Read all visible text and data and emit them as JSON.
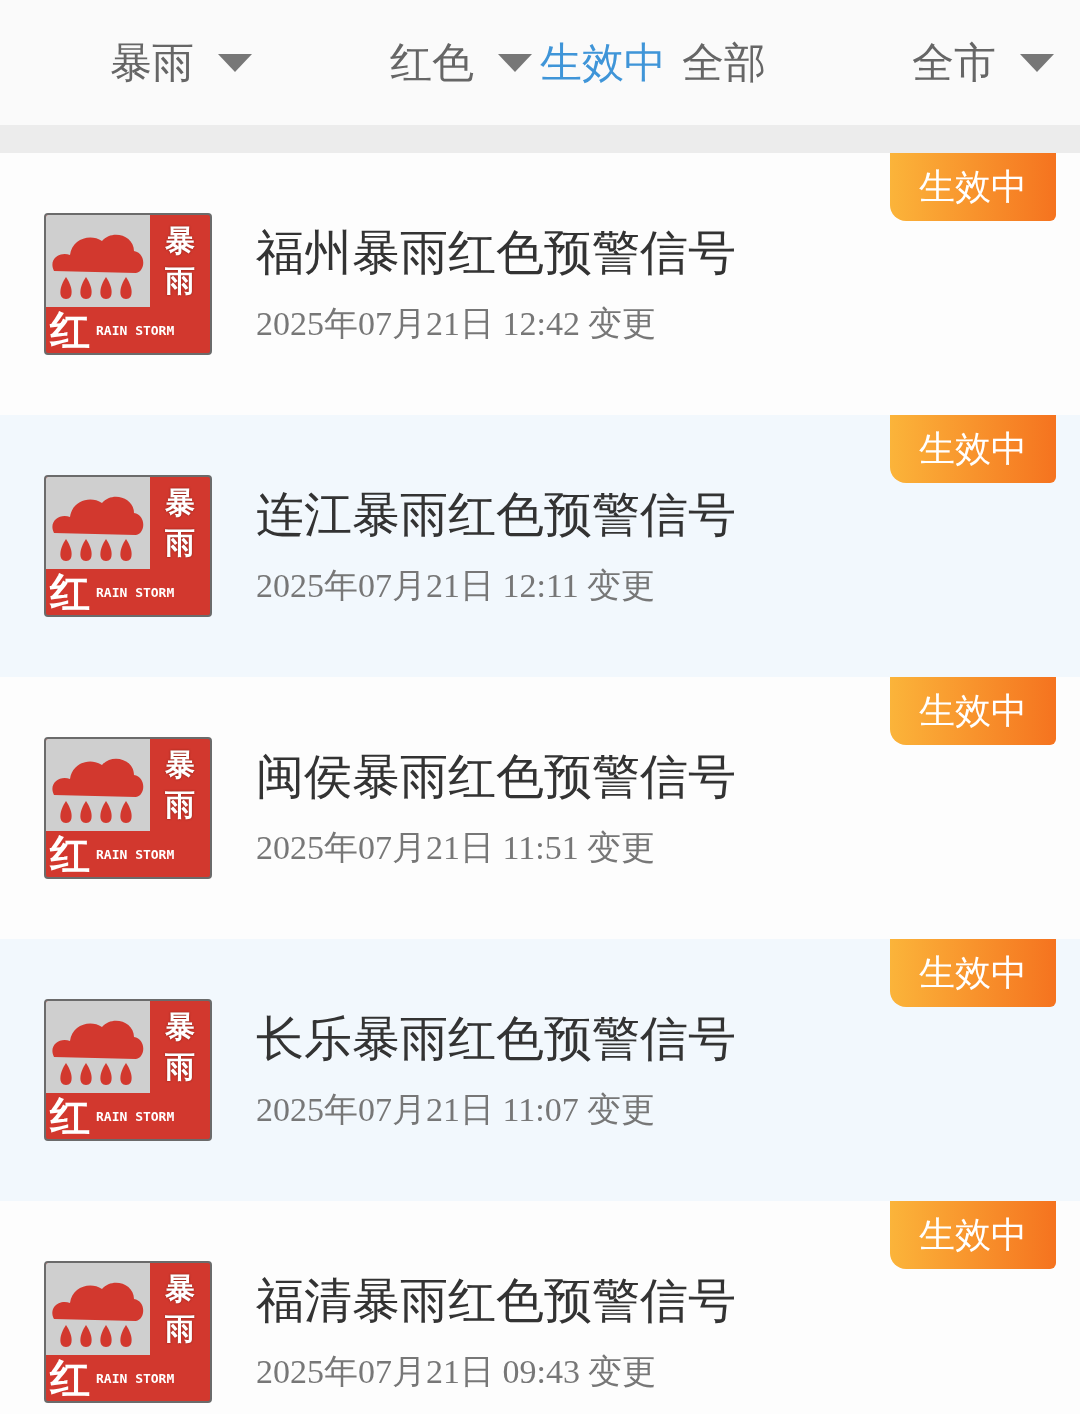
{
  "filters": [
    {
      "label": "暴雨",
      "dropdown": true
    },
    {
      "label": "红色",
      "dropdown": true
    }
  ],
  "status_toggle": [
    {
      "label": "生效中",
      "selected": true
    },
    {
      "label": "全部",
      "selected": false
    }
  ],
  "area_filter": {
    "label": "全市",
    "dropdown": true
  },
  "warnings": [
    {
      "signal": {
        "top": "暴",
        "middle": "雨",
        "level": "红",
        "english": "RAIN STORM"
      },
      "title": "福州暴雨红色预警信号",
      "time": "2025年07月21日 12:42 变更",
      "badge": "生效中"
    },
    {
      "signal": {
        "top": "暴",
        "middle": "雨",
        "level": "红",
        "english": "RAIN STORM"
      },
      "title": "连江暴雨红色预警信号",
      "time": "2025年07月21日 12:11 变更",
      "badge": "生效中"
    },
    {
      "signal": {
        "top": "暴",
        "middle": "雨",
        "level": "红",
        "english": "RAIN STORM"
      },
      "title": "闽侯暴雨红色预警信号",
      "time": "2025年07月21日 11:51 变更",
      "badge": "生效中"
    },
    {
      "signal": {
        "top": "暴",
        "middle": "雨",
        "level": "红",
        "english": "RAIN STORM"
      },
      "title": "长乐暴雨红色预警信号",
      "time": "2025年07月21日 11:07 变更",
      "badge": "生效中"
    },
    {
      "signal": {
        "top": "暴",
        "middle": "雨",
        "level": "红",
        "english": "RAIN STORM"
      },
      "title": "福清暴雨红色预警信号",
      "time": "2025年07月21日 09:43 变更",
      "badge": "生效中"
    }
  ]
}
